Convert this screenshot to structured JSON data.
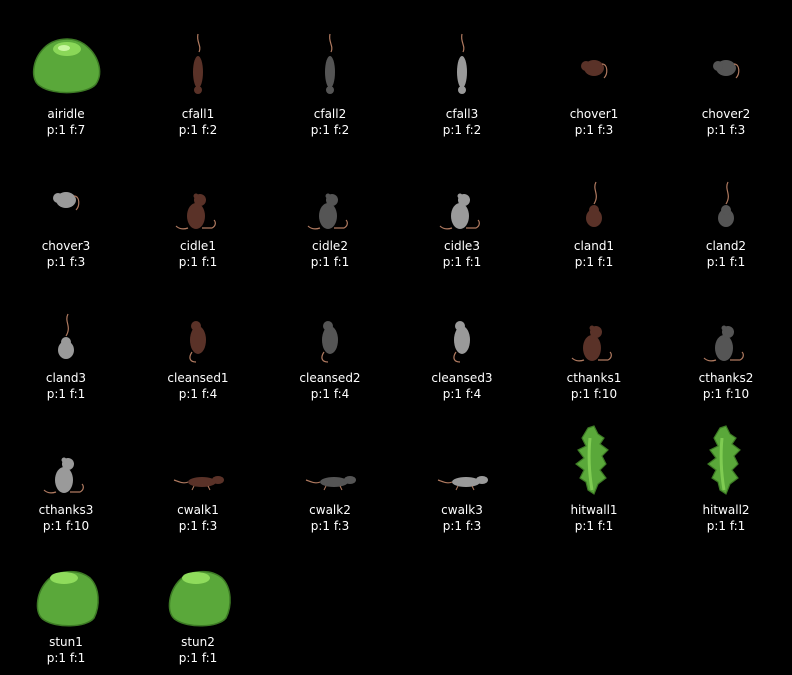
{
  "sprites": [
    {
      "name": "airidle",
      "info": "p:1 f:7",
      "kind": "blob-idle",
      "color": "#5aa83a"
    },
    {
      "name": "cfall1",
      "info": "p:1 f:2",
      "kind": "rat-fall",
      "color": "#5a3228"
    },
    {
      "name": "cfall2",
      "info": "p:1 f:2",
      "kind": "rat-fall",
      "color": "#555555"
    },
    {
      "name": "cfall3",
      "info": "p:1 f:2",
      "kind": "rat-fall",
      "color": "#9a9a9a"
    },
    {
      "name": "chover1",
      "info": "p:1 f:3",
      "kind": "rat-hover",
      "color": "#5a3228"
    },
    {
      "name": "chover2",
      "info": "p:1 f:3",
      "kind": "rat-hover",
      "color": "#555555"
    },
    {
      "name": "chover3",
      "info": "p:1 f:3",
      "kind": "rat-hover",
      "color": "#9a9a9a"
    },
    {
      "name": "cidle1",
      "info": "p:1 f:1",
      "kind": "rat-sit",
      "color": "#5a3228"
    },
    {
      "name": "cidle2",
      "info": "p:1 f:1",
      "kind": "rat-sit",
      "color": "#555555"
    },
    {
      "name": "cidle3",
      "info": "p:1 f:1",
      "kind": "rat-sit",
      "color": "#9a9a9a"
    },
    {
      "name": "cland1",
      "info": "p:1 f:1",
      "kind": "rat-land",
      "color": "#5a3228"
    },
    {
      "name": "cland2",
      "info": "p:1 f:1",
      "kind": "rat-land",
      "color": "#555555"
    },
    {
      "name": "cland3",
      "info": "p:1 f:1",
      "kind": "rat-land",
      "color": "#9a9a9a"
    },
    {
      "name": "cleansed1",
      "info": "p:1 f:4",
      "kind": "rat-clean",
      "color": "#5a3228"
    },
    {
      "name": "cleansed2",
      "info": "p:1 f:4",
      "kind": "rat-clean",
      "color": "#555555"
    },
    {
      "name": "cleansed3",
      "info": "p:1 f:4",
      "kind": "rat-clean",
      "color": "#9a9a9a"
    },
    {
      "name": "cthanks1",
      "info": "p:1 f:10",
      "kind": "rat-sit",
      "color": "#5a3228"
    },
    {
      "name": "cthanks2",
      "info": "p:1 f:10",
      "kind": "rat-sit",
      "color": "#555555"
    },
    {
      "name": "cthanks3",
      "info": "p:1 f:10",
      "kind": "rat-sit",
      "color": "#9a9a9a"
    },
    {
      "name": "cwalk1",
      "info": "p:1 f:3",
      "kind": "rat-walk",
      "color": "#5a3228"
    },
    {
      "name": "cwalk2",
      "info": "p:1 f:3",
      "kind": "rat-walk",
      "color": "#555555"
    },
    {
      "name": "cwalk3",
      "info": "p:1 f:3",
      "kind": "rat-walk",
      "color": "#9a9a9a"
    },
    {
      "name": "hitwall1",
      "info": "p:1 f:1",
      "kind": "blob-wall",
      "color": "#5aa83a"
    },
    {
      "name": "hitwall2",
      "info": "p:1 f:1",
      "kind": "blob-wall",
      "color": "#5aa83a"
    },
    {
      "name": "stun1",
      "info": "p:1 f:1",
      "kind": "blob-stun",
      "color": "#5aa83a"
    },
    {
      "name": "stun2",
      "info": "p:1 f:1",
      "kind": "blob-stun",
      "color": "#5aa83a"
    }
  ]
}
